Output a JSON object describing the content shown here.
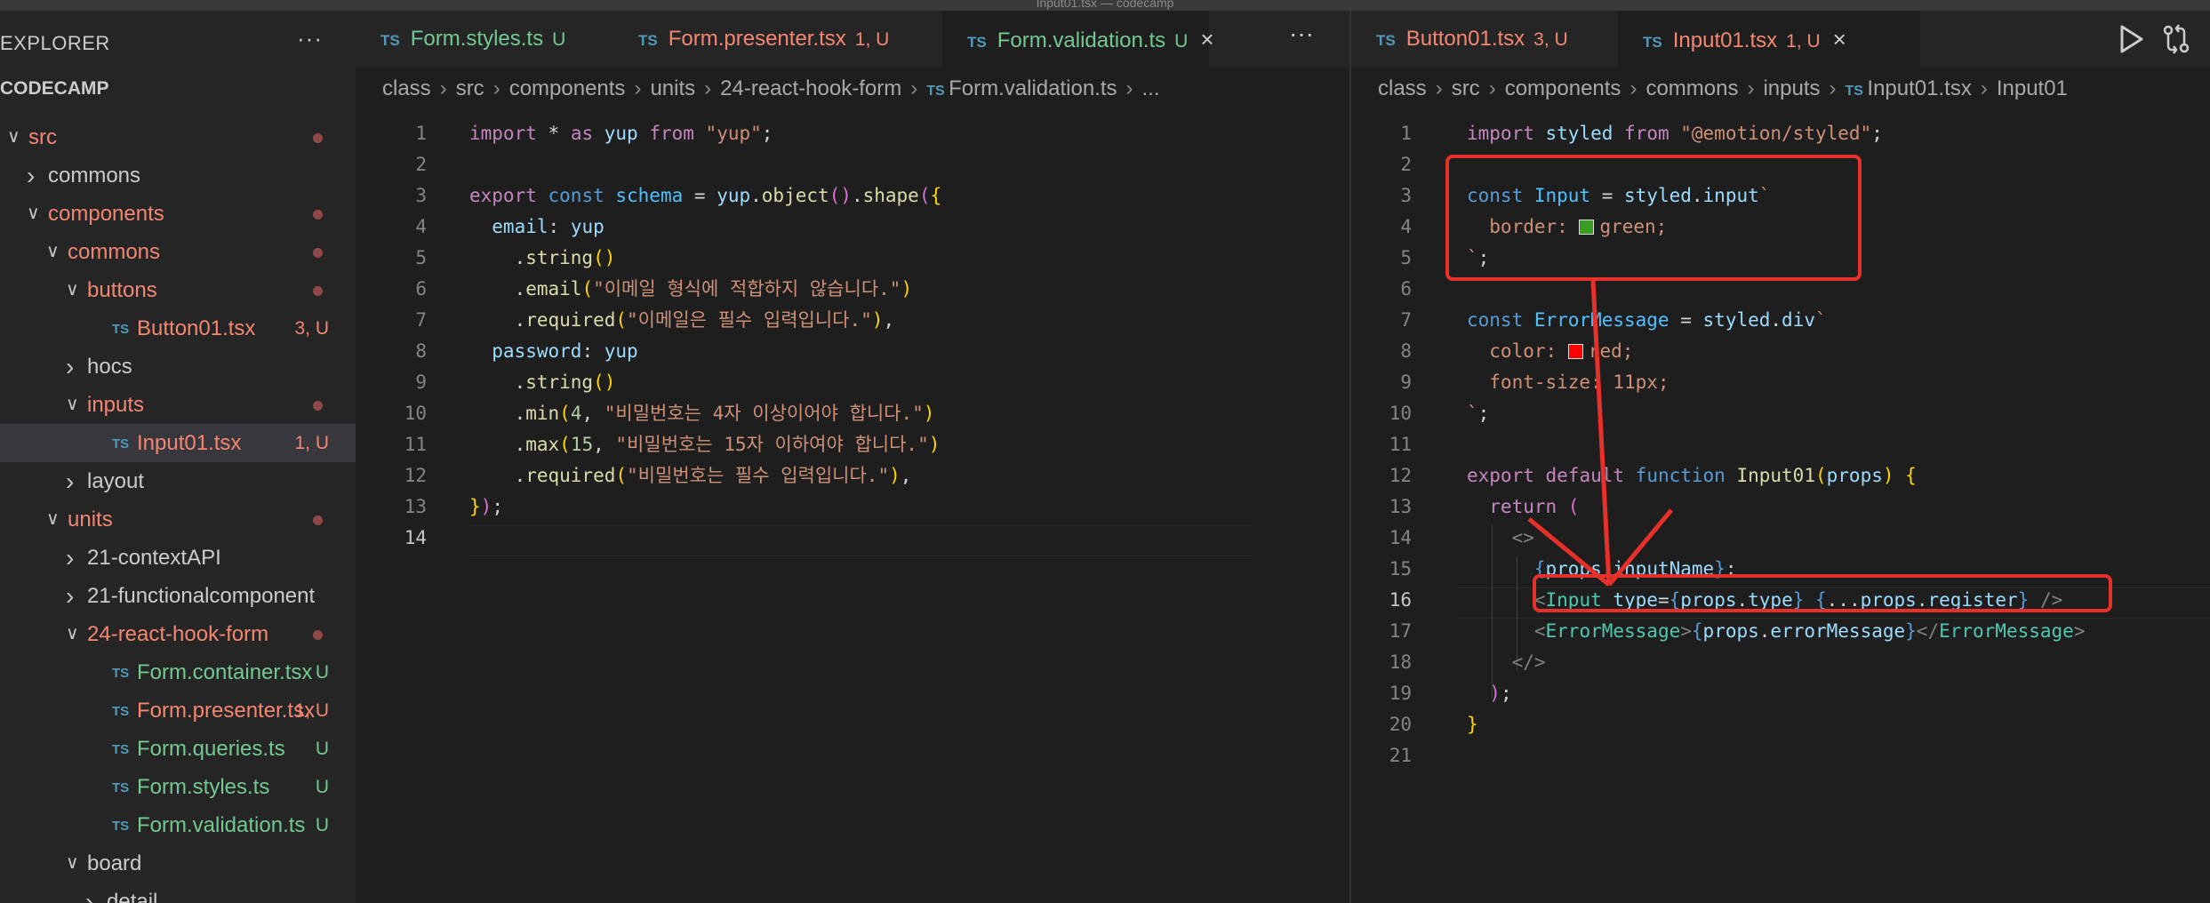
{
  "window": {
    "title": "Input01.tsx — codecamp"
  },
  "explorer": {
    "title": "EXPLORER",
    "more": "···",
    "root": "CODECAMP",
    "tree": [
      {
        "label": "src",
        "indent": 0,
        "kind": "folder-open",
        "color": "red",
        "dot": true
      },
      {
        "label": "commons",
        "indent": 1,
        "kind": "folder-closed",
        "color": "white"
      },
      {
        "label": "components",
        "indent": 1,
        "kind": "folder-open",
        "color": "red",
        "dot": true
      },
      {
        "label": "commons",
        "indent": 2,
        "kind": "folder-open",
        "color": "red",
        "dot": true
      },
      {
        "label": "buttons",
        "indent": 3,
        "kind": "folder-open",
        "color": "red",
        "dot": true
      },
      {
        "label": "Button01.tsx",
        "indent": 4,
        "kind": "file",
        "color": "red",
        "status": "3, U"
      },
      {
        "label": "hocs",
        "indent": 3,
        "kind": "folder-closed",
        "color": "white"
      },
      {
        "label": "inputs",
        "indent": 3,
        "kind": "folder-open",
        "color": "red",
        "dot": true
      },
      {
        "label": "Input01.tsx",
        "indent": 4,
        "kind": "file",
        "color": "red",
        "status": "1, U",
        "selected": true
      },
      {
        "label": "layout",
        "indent": 3,
        "kind": "folder-closed",
        "color": "white"
      },
      {
        "label": "units",
        "indent": 2,
        "kind": "folder-open",
        "color": "red",
        "dot": true
      },
      {
        "label": "21-contextAPI",
        "indent": 3,
        "kind": "folder-closed",
        "color": "white"
      },
      {
        "label": "21-functionalcomponent",
        "indent": 3,
        "kind": "folder-closed",
        "color": "white"
      },
      {
        "label": "24-react-hook-form",
        "indent": 3,
        "kind": "folder-open",
        "color": "red",
        "dot": true
      },
      {
        "label": "Form.container.tsx",
        "indent": 4,
        "kind": "file",
        "color": "green",
        "status": "U"
      },
      {
        "label": "Form.presenter.tsx",
        "indent": 4,
        "kind": "file",
        "color": "red",
        "status": "1, U"
      },
      {
        "label": "Form.queries.ts",
        "indent": 4,
        "kind": "file",
        "color": "green",
        "status": "U"
      },
      {
        "label": "Form.styles.ts",
        "indent": 4,
        "kind": "file",
        "color": "green",
        "status": "U"
      },
      {
        "label": "Form.validation.ts",
        "indent": 4,
        "kind": "file",
        "color": "green",
        "status": "U"
      },
      {
        "label": "board",
        "indent": 3,
        "kind": "folder-open",
        "color": "white"
      },
      {
        "label": "detail",
        "indent": 4,
        "kind": "folder-closed",
        "color": "white"
      }
    ]
  },
  "left_editor": {
    "tabs": [
      {
        "label": "Form.styles.ts",
        "status": "U",
        "color": "green",
        "active": false
      },
      {
        "label": "Form.presenter.tsx",
        "status": "1, U",
        "color": "red",
        "active": false
      },
      {
        "label": "Form.validation.ts",
        "status": "U",
        "color": "green",
        "active": true,
        "close": "×"
      }
    ],
    "more": "···",
    "breadcrumb": [
      "class",
      "src",
      "components",
      "units",
      "24-react-hook-form",
      "Form.validation.ts",
      "..."
    ],
    "current_line": 14,
    "lines": [
      [
        [
          "import ",
          "kw"
        ],
        [
          "* ",
          "punc"
        ],
        [
          "as ",
          "kw"
        ],
        [
          "yup ",
          "var"
        ],
        [
          "from ",
          "kw"
        ],
        [
          "\"yup\"",
          "str"
        ],
        [
          ";",
          "punc"
        ]
      ],
      [],
      [
        [
          "export ",
          "kw"
        ],
        [
          "const ",
          "blue"
        ],
        [
          "schema ",
          "const"
        ],
        [
          "= ",
          "punc"
        ],
        [
          "yup",
          "var"
        ],
        [
          ".",
          "punc"
        ],
        [
          "object",
          "fn"
        ],
        [
          "()",
          "brk2"
        ],
        [
          ".",
          "punc"
        ],
        [
          "shape",
          "fn"
        ],
        [
          "(",
          "brk2"
        ],
        [
          "{",
          "brk"
        ]
      ],
      [
        [
          "  email",
          "var"
        ],
        [
          ": ",
          "punc"
        ],
        [
          "yup",
          "var"
        ]
      ],
      [
        [
          "    .",
          "punc"
        ],
        [
          "string",
          "fn"
        ],
        [
          "()",
          "brk"
        ]
      ],
      [
        [
          "    .",
          "punc"
        ],
        [
          "email",
          "fn"
        ],
        [
          "(",
          "brk"
        ],
        [
          "\"이메일 형식에 적합하지 않습니다.\"",
          "str"
        ],
        [
          ")",
          "brk"
        ]
      ],
      [
        [
          "    .",
          "punc"
        ],
        [
          "required",
          "fn"
        ],
        [
          "(",
          "brk"
        ],
        [
          "\"이메일은 필수 입력입니다.\"",
          "str"
        ],
        [
          ")",
          "brk"
        ],
        [
          ",",
          "punc"
        ]
      ],
      [
        [
          "  password",
          "var"
        ],
        [
          ": ",
          "punc"
        ],
        [
          "yup",
          "var"
        ]
      ],
      [
        [
          "    .",
          "punc"
        ],
        [
          "string",
          "fn"
        ],
        [
          "()",
          "brk"
        ]
      ],
      [
        [
          "    .",
          "punc"
        ],
        [
          "min",
          "fn"
        ],
        [
          "(",
          "brk"
        ],
        [
          "4",
          "num"
        ],
        [
          ", ",
          "punc"
        ],
        [
          "\"비밀번호는 4자 이상이어야 합니다.\"",
          "str"
        ],
        [
          ")",
          "brk"
        ]
      ],
      [
        [
          "    .",
          "punc"
        ],
        [
          "max",
          "fn"
        ],
        [
          "(",
          "brk"
        ],
        [
          "15",
          "num"
        ],
        [
          ", ",
          "punc"
        ],
        [
          "\"비밀번호는 15자 이하여야 합니다.\"",
          "str"
        ],
        [
          ")",
          "brk"
        ]
      ],
      [
        [
          "    .",
          "punc"
        ],
        [
          "required",
          "fn"
        ],
        [
          "(",
          "brk"
        ],
        [
          "\"비밀번호는 필수 입력입니다.\"",
          "str"
        ],
        [
          ")",
          "brk"
        ],
        [
          ",",
          "punc"
        ]
      ],
      [
        [
          "}",
          "brk"
        ],
        [
          ")",
          "brk2"
        ],
        [
          ";",
          "punc"
        ]
      ],
      []
    ]
  },
  "right_editor": {
    "tabs": [
      {
        "label": "Button01.tsx",
        "status": "3, U",
        "color": "red",
        "active": false
      },
      {
        "label": "Input01.tsx",
        "status": "1, U",
        "color": "red",
        "active": true,
        "close": "×"
      }
    ],
    "run_icon": "play-icon",
    "compare_icon": "source-compare-icon",
    "breadcrumb": [
      "class",
      "src",
      "components",
      "commons",
      "inputs",
      "Input01.tsx",
      "Input01"
    ],
    "current_line": 16,
    "lines": [
      [
        [
          "import ",
          "kw"
        ],
        [
          "styled ",
          "var"
        ],
        [
          "from ",
          "kw"
        ],
        [
          "\"@emotion/styled\"",
          "str"
        ],
        [
          ";",
          "punc"
        ]
      ],
      [],
      [
        [
          "const ",
          "blue"
        ],
        [
          "Input ",
          "const"
        ],
        [
          "= ",
          "punc"
        ],
        [
          "styled",
          "var"
        ],
        [
          ".",
          "punc"
        ],
        [
          "input",
          "var"
        ],
        [
          "`",
          "str"
        ]
      ],
      [
        [
          "  border: ",
          "str"
        ],
        [
          "SWATCH:#3a9d23",
          "swatch"
        ],
        [
          "green;",
          "str"
        ]
      ],
      [
        [
          "`",
          "str"
        ],
        [
          ";",
          "punc"
        ]
      ],
      [],
      [
        [
          "const ",
          "blue"
        ],
        [
          "ErrorMessage ",
          "const"
        ],
        [
          "= ",
          "punc"
        ],
        [
          "styled",
          "var"
        ],
        [
          ".",
          "punc"
        ],
        [
          "div",
          "var"
        ],
        [
          "`",
          "str"
        ]
      ],
      [
        [
          "  color: ",
          "str"
        ],
        [
          "SWATCH:#ff0000",
          "swatch"
        ],
        [
          "red;",
          "str"
        ]
      ],
      [
        [
          "  font-size: 11px;",
          "str"
        ]
      ],
      [
        [
          "`",
          "str"
        ],
        [
          ";",
          "punc"
        ]
      ],
      [],
      [
        [
          "export ",
          "kw"
        ],
        [
          "default ",
          "kw"
        ],
        [
          "function ",
          "blue"
        ],
        [
          "Input01",
          "fn"
        ],
        [
          "(",
          "brk"
        ],
        [
          "props",
          "var"
        ],
        [
          ") ",
          "brk"
        ],
        [
          "{",
          "brk"
        ]
      ],
      [
        [
          "  return ",
          "kw"
        ],
        [
          "(",
          "brk2"
        ]
      ],
      [
        [
          "    <>",
          "tagp"
        ]
      ],
      [
        [
          "      {",
          "blue"
        ],
        [
          "props",
          "var"
        ],
        [
          ".",
          "punc"
        ],
        [
          "inputName",
          "var"
        ],
        [
          "}",
          "blue"
        ],
        [
          ":",
          "punc"
        ]
      ],
      [
        [
          "      <",
          "tagp"
        ],
        [
          "Input ",
          "tag"
        ],
        [
          "type",
          "var"
        ],
        [
          "=",
          "punc"
        ],
        [
          "{",
          "blue"
        ],
        [
          "props",
          "var"
        ],
        [
          ".",
          "punc"
        ],
        [
          "type",
          "var"
        ],
        [
          "} ",
          "blue"
        ],
        [
          "{",
          "blue"
        ],
        [
          "...",
          "punc"
        ],
        [
          "props",
          "var"
        ],
        [
          ".",
          "punc"
        ],
        [
          "register",
          "var"
        ],
        [
          "} ",
          "blue"
        ],
        [
          "/>",
          "tagp"
        ]
      ],
      [
        [
          "      <",
          "tagp"
        ],
        [
          "ErrorMessage",
          "tag"
        ],
        [
          ">",
          "tagp"
        ],
        [
          "{",
          "blue"
        ],
        [
          "props",
          "var"
        ],
        [
          ".",
          "punc"
        ],
        [
          "errorMessage",
          "var"
        ],
        [
          "}",
          "blue"
        ],
        [
          "</",
          "tagp"
        ],
        [
          "ErrorMessage",
          "tag"
        ],
        [
          ">",
          "tagp"
        ]
      ],
      [
        [
          "    </>",
          "tagp"
        ]
      ],
      [
        [
          "  )",
          "brk2"
        ],
        [
          ";",
          "punc"
        ]
      ],
      [
        [
          "}",
          "brk"
        ]
      ],
      []
    ]
  },
  "annotation": {
    "color": "#e8302a"
  }
}
